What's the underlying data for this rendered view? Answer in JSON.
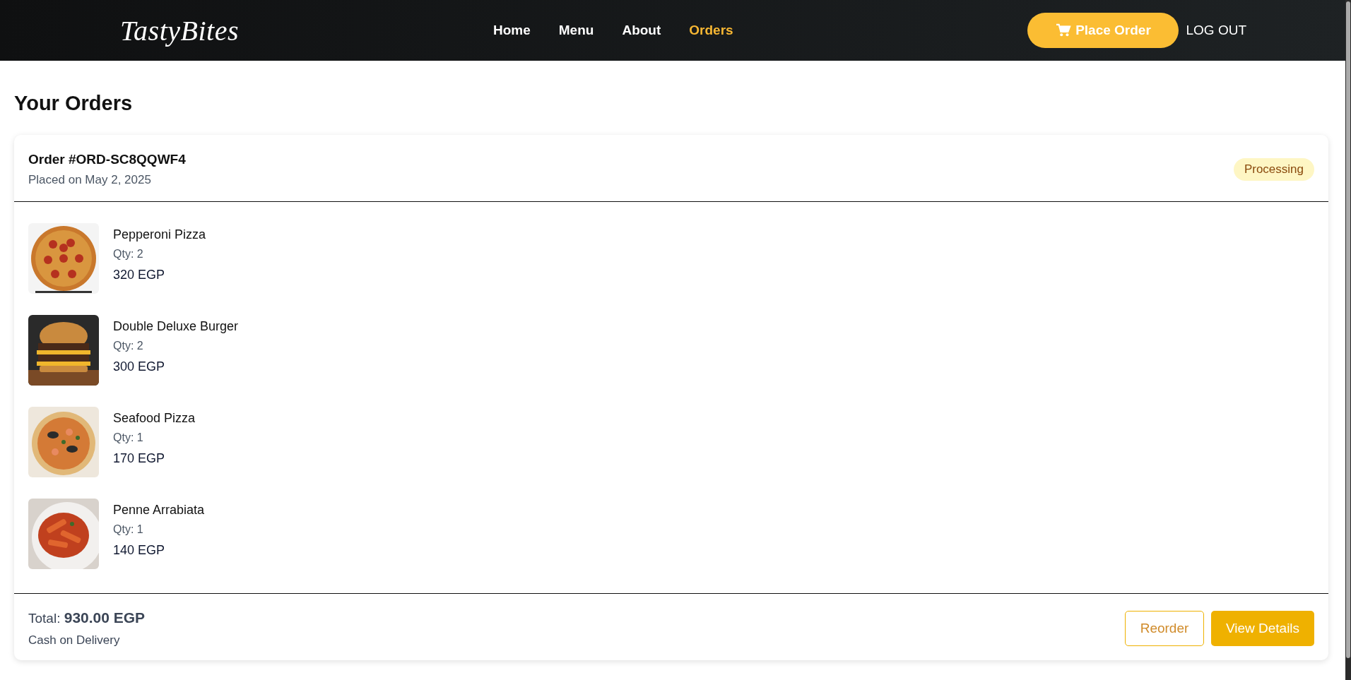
{
  "header": {
    "logo": "TastyBites",
    "nav": [
      {
        "label": "Home",
        "selected": false
      },
      {
        "label": "Menu",
        "selected": false
      },
      {
        "label": "About",
        "selected": false
      },
      {
        "label": "Orders",
        "selected": true
      }
    ],
    "order_button": "Place Order",
    "logout": "LOG OUT"
  },
  "page_title": "Your Orders",
  "order": {
    "number": "Order #ORD-SC8QQWF4",
    "placed": "Placed on May 2, 2025",
    "status": {
      "label": "Processing",
      "kind": "processing"
    },
    "items": [
      {
        "name": "Pepperoni Pizza",
        "qty": "Qty: 2",
        "price": "320 EGP",
        "kind": "pizza"
      },
      {
        "name": "Double Deluxe Burger",
        "qty": "Qty: 2",
        "price": "300 EGP",
        "kind": "burger"
      },
      {
        "name": "Seafood Pizza",
        "qty": "Qty: 1",
        "price": "170 EGP",
        "kind": "seafood"
      },
      {
        "name": "Penne Arrabiata",
        "qty": "Qty: 1",
        "price": "140 EGP",
        "kind": "pasta"
      }
    ],
    "total": "Total: **930.00 EGP**",
    "payment": "Cash on Delivery",
    "buttons": [
      {
        "label": "Reorder",
        "kind": "outline"
      },
      {
        "label": "View Details",
        "kind": "primary"
      }
    ]
  }
}
